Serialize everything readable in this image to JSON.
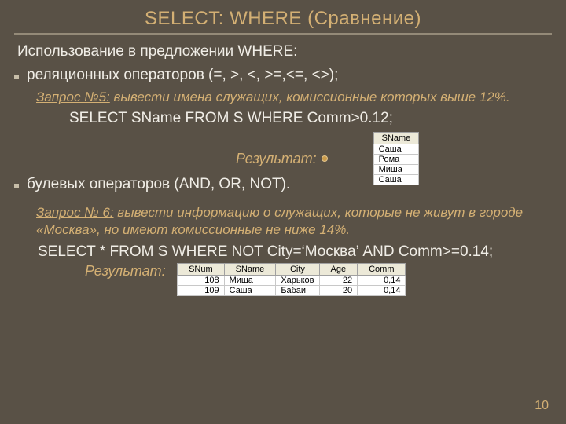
{
  "title": "SELECT: WHERE (Сравнение)",
  "intro": "Использование в предложении WHERE:",
  "bullet1": "реляционных операторов (=, >, <, >=,<=, <>);",
  "query5": {
    "label": "Запрос №5:",
    "text": " вывести имена служащих, комиссионные которых выше 12%."
  },
  "sql1": "SELECT SName FROM  S WHERE Comm>0.12;",
  "result_label": "Результат:",
  "table1": {
    "header": "SName",
    "rows": [
      "Саша",
      "Рома",
      "Миша",
      "Саша"
    ]
  },
  "bullet2": "булевых операторов (AND, OR, NOT).",
  "query6": {
    "label": "Запрос № 6:",
    "text": " вывести информацию о служащих, которые не живут в городе «Москва», но имеют комиссионные не ниже 14%."
  },
  "sql2": "SELECT * FROM  S WHERE NOT City=‘Москва’ AND Comm>=0.14;",
  "table2": {
    "headers": [
      "SNum",
      "SName",
      "City",
      "Age",
      "Comm"
    ],
    "rows": [
      [
        "108",
        "Миша",
        "Харьков",
        "22",
        "0,14"
      ],
      [
        "109",
        "Саша",
        "Бабаи",
        "20",
        "0,14"
      ]
    ]
  },
  "pagenum": "10"
}
